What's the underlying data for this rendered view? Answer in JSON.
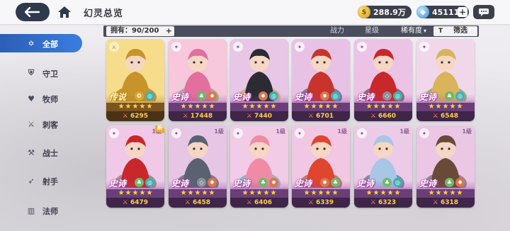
{
  "header": {
    "title": "幻灵总览",
    "gold_amount": "288.9万",
    "gem_amount": "45111",
    "add_symbol": "+"
  },
  "sidebar": {
    "items": [
      {
        "key": "all",
        "label": "全部",
        "icon": "star-outline-icon",
        "active": true
      },
      {
        "key": "guard",
        "label": "守卫",
        "icon": "shield-icon",
        "active": false
      },
      {
        "key": "priest",
        "label": "牧师",
        "icon": "heart-cross-icon",
        "active": false
      },
      {
        "key": "assassin",
        "label": "刺客",
        "icon": "dagger-icon",
        "active": false
      },
      {
        "key": "warrior",
        "label": "战士",
        "icon": "axe-icon",
        "active": false
      },
      {
        "key": "archer",
        "label": "射手",
        "icon": "bow-icon",
        "active": false
      },
      {
        "key": "mage",
        "label": "法师",
        "icon": "book-icon",
        "active": false
      }
    ]
  },
  "filter": {
    "owned_label": "拥有：90/200",
    "owned_adjust": "+",
    "power_label": "战力",
    "star_label": "星级",
    "rarity_label": "稀有度",
    "rarity_arrow": "▾",
    "filter_icon": "T",
    "filter_label": "筛选"
  },
  "cards": [
    {
      "rarity": "传说",
      "power": "6295",
      "stars": 5,
      "level": "",
      "new": false,
      "tier": "legend",
      "art": "golden-knight",
      "badges": [
        "gold",
        "teal"
      ]
    },
    {
      "rarity": "史诗",
      "power": "17448",
      "stars": 5,
      "level": "",
      "new": false,
      "tier": "epic",
      "art": "pink-fairy",
      "badges": [
        "green",
        "red"
      ]
    },
    {
      "rarity": "史诗",
      "power": "7440",
      "stars": 5,
      "level": "",
      "new": false,
      "tier": "epic",
      "art": "dark-ninja",
      "badges": [
        "red",
        "teal"
      ]
    },
    {
      "rarity": "史诗",
      "power": "6701",
      "stars": 5,
      "level": "",
      "new": false,
      "tier": "epic",
      "art": "red-mage",
      "badges": [
        "red",
        "teal"
      ]
    },
    {
      "rarity": "史诗",
      "power": "6660",
      "stars": 5,
      "level": "",
      "new": false,
      "tier": "epic",
      "art": "red-demon",
      "badges": [
        "grey",
        "teal"
      ]
    },
    {
      "rarity": "史诗",
      "power": "6548",
      "stars": 5,
      "level": "",
      "new": false,
      "tier": "epic",
      "art": "horned-druid",
      "badges": [
        "green",
        "teal"
      ]
    },
    {
      "rarity": "史诗",
      "power": "6479",
      "stars": 5,
      "level": "1级",
      "new": true,
      "tier": "epic",
      "art": "red-dwarf",
      "badges": [
        "green",
        "teal"
      ]
    },
    {
      "rarity": "史诗",
      "power": "6458",
      "stars": 5,
      "level": "1级",
      "new": false,
      "tier": "epic",
      "art": "werewolf",
      "badges": [
        "grey",
        "red"
      ]
    },
    {
      "rarity": "史诗",
      "power": "6406",
      "stars": 5,
      "level": "1级",
      "new": false,
      "tier": "epic",
      "art": "mermaid",
      "badges": [
        "green",
        "red"
      ]
    },
    {
      "rarity": "史诗",
      "power": "6339",
      "stars": 5,
      "level": "1级",
      "new": false,
      "tier": "epic",
      "art": "fire-beast",
      "badges": [
        "red",
        "green"
      ]
    },
    {
      "rarity": "史诗",
      "power": "6323",
      "stars": 5,
      "level": "1级",
      "new": false,
      "tier": "epic",
      "art": "ice-spirit",
      "badges": [
        "green",
        "teal"
      ]
    },
    {
      "rarity": "史诗",
      "power": "6318",
      "stars": 5,
      "level": "1级",
      "new": false,
      "tier": "epic",
      "art": "armored-brute",
      "badges": [
        "green",
        "red"
      ]
    }
  ],
  "new_tag": "新",
  "colors": {
    "accent": "#3a7de0",
    "epic": "#d9a4de",
    "legend": "#e9c577",
    "power": "#ffcf45"
  }
}
